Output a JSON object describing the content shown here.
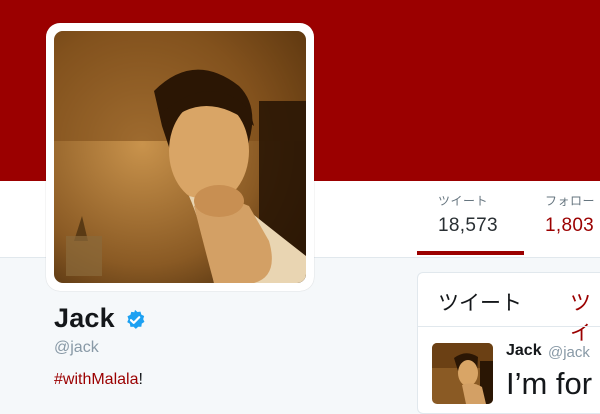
{
  "profile": {
    "name": "Jack",
    "handle": "@jack",
    "bio_hashtag": "#withMalala",
    "bio_suffix": "!"
  },
  "stats": {
    "tweets_label": "ツイート",
    "tweets_value": "18,573",
    "following_label": "フォロー",
    "following_value": "1,803"
  },
  "timeline": {
    "tab_tweets": "ツイート",
    "tab_replies": "ツイ",
    "tweet": {
      "author": "Jack",
      "handle": "@jack",
      "text": "I’m for"
    }
  },
  "theme": {
    "accent": "#9b0000",
    "banner": "#9b0000",
    "verified": "#1da1f2"
  },
  "icons": {
    "verified": "verified-badge-icon"
  }
}
